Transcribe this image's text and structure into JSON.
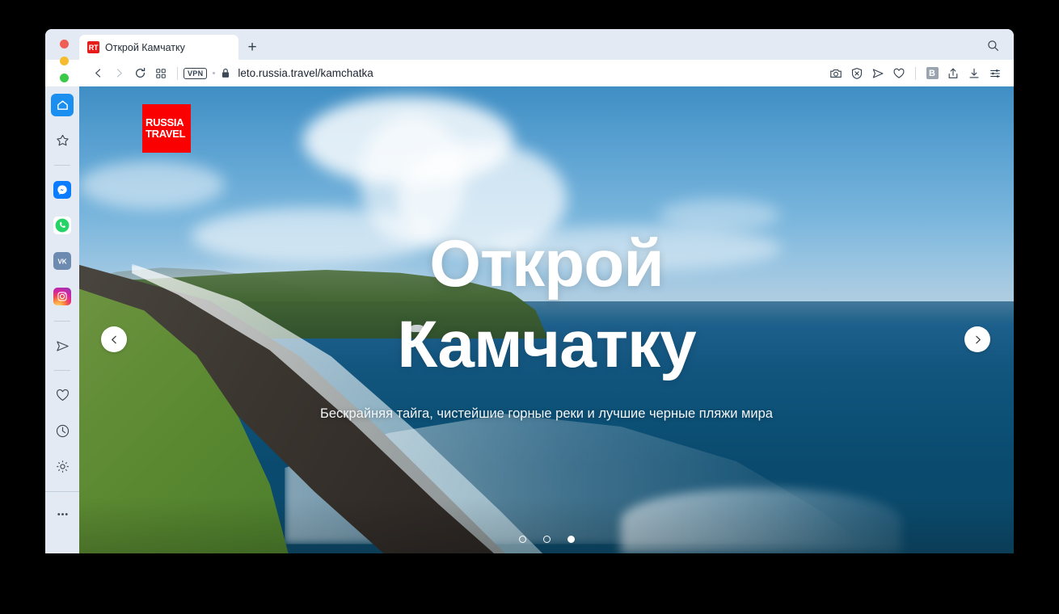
{
  "browser": {
    "window_controls": [
      "close",
      "minimize",
      "maximize"
    ],
    "tab": {
      "favicon_text": "RT",
      "title": "Открой Камчатку"
    },
    "new_tab_label": "+",
    "search_icon": "search-icon",
    "address": {
      "back_icon": "chevron-left-icon",
      "forward_icon": "chevron-right-icon",
      "reload_icon": "reload-icon",
      "panels_icon": "grid-panels-icon",
      "vpn_label": "VPN",
      "lock_icon": "lock-icon",
      "url": "leto.russia.travel/kamchatka"
    },
    "toolbar_right": [
      {
        "name": "capture-page-icon",
        "glyph": "camera"
      },
      {
        "name": "ad-blocker-icon",
        "glyph": "shield-x"
      },
      {
        "name": "send-page-icon",
        "glyph": "paper-plane"
      },
      {
        "name": "add-bookmark-icon",
        "glyph": "heart"
      },
      {
        "name": "bookmarks-icon",
        "glyph": "B"
      },
      {
        "name": "share-icon",
        "glyph": "share-up"
      },
      {
        "name": "downloads-icon",
        "glyph": "download"
      },
      {
        "name": "page-actions-icon",
        "glyph": "sliders"
      }
    ],
    "sidebar": {
      "items": [
        {
          "name": "home-panel",
          "icon": "home-icon",
          "active": true
        },
        {
          "name": "bookmarks-panel",
          "icon": "star-icon",
          "active": false
        },
        {
          "name": "divider-1",
          "icon": "divider",
          "active": false
        },
        {
          "name": "messenger-panel",
          "icon": "messenger-icon",
          "active": false
        },
        {
          "name": "whatsapp-panel",
          "icon": "whatsapp-icon",
          "active": false
        },
        {
          "name": "vk-panel",
          "icon": "vk-icon",
          "active": false
        },
        {
          "name": "instagram-panel",
          "icon": "instagram-icon",
          "active": false
        },
        {
          "name": "divider-2",
          "icon": "divider",
          "active": false
        },
        {
          "name": "telegram-panel",
          "icon": "paper-plane-icon",
          "active": false
        },
        {
          "name": "divider-3",
          "icon": "divider",
          "active": false
        },
        {
          "name": "favorites-panel",
          "icon": "heart-icon",
          "active": false
        },
        {
          "name": "history-panel",
          "icon": "clock-icon",
          "active": false
        },
        {
          "name": "settings-panel",
          "icon": "gear-icon",
          "active": false
        },
        {
          "name": "more-panel",
          "icon": "ellipsis-icon",
          "active": false
        }
      ]
    }
  },
  "page": {
    "logo": {
      "line1": "RUSSIA",
      "line2": "TRAVEL",
      "background": "#fb0000"
    },
    "hero": {
      "title_line1": "Открой",
      "title_line2": "Камчатку",
      "subtitle": "Бескрайняя тайга, чистейшие горные реки и лучшие черные пляжи мира",
      "prev_icon": "chevron-left-icon",
      "next_icon": "chevron-right-icon",
      "slide_count": 3,
      "active_slide": 3
    }
  }
}
